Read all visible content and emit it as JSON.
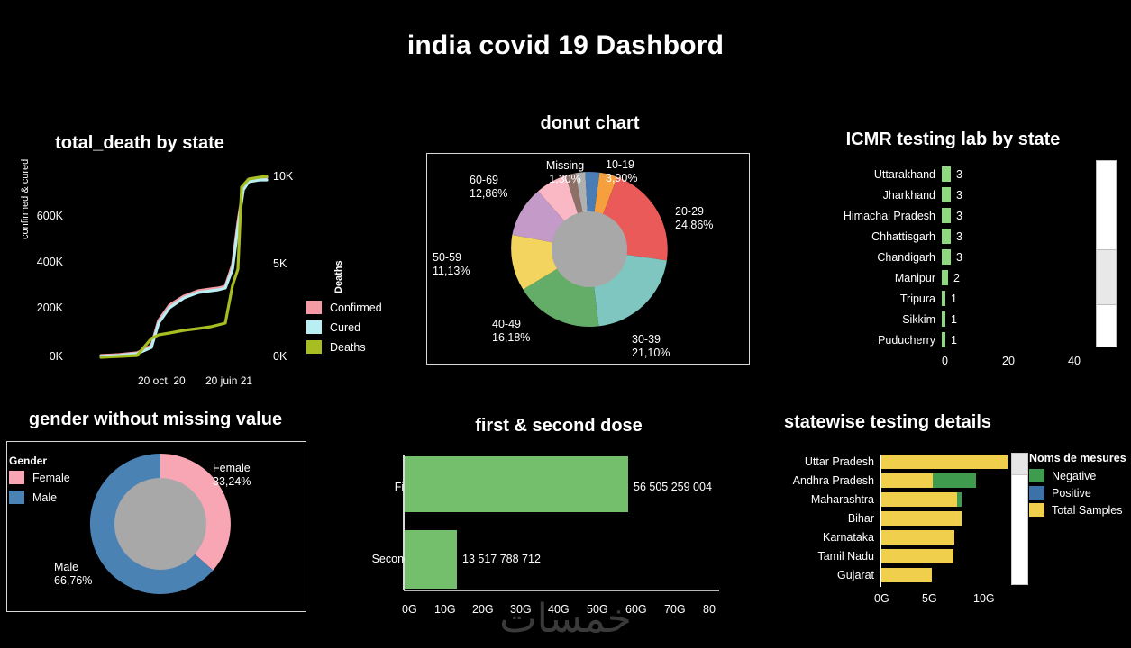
{
  "title": "india covid 19 Dashbord",
  "watermark": "خمسات",
  "line_chart": {
    "title": "total_death by state",
    "y_left_label": "confirmed & cured",
    "y_right_label": "Deaths",
    "y_left_ticks": [
      "600K",
      "400K",
      "200K",
      "0K"
    ],
    "y_right_ticks": [
      "10K",
      "5K",
      "0K"
    ],
    "x_ticks": [
      "20 oct. 20",
      "20 juin 21"
    ],
    "legend": [
      {
        "label": "Confirmed",
        "color": "#f49ba5"
      },
      {
        "label": "Cured",
        "color": "#b9eef2"
      },
      {
        "label": "Deaths",
        "color": "#a7bd22"
      }
    ]
  },
  "donut_chart": {
    "title": "donut chart",
    "labels": {
      "missing_name": "Missing",
      "missing_pct": "1,30%",
      "a1019_name": "10-19",
      "a1019_pct": "3,90%",
      "a2029_name": "20-29",
      "a2029_pct": "24,86%",
      "a3039_name": "30-39",
      "a3039_pct": "21,10%",
      "a4049_name": "40-49",
      "a4049_pct": "16,18%",
      "a5059_name": "50-59",
      "a5059_pct": "11,13%",
      "a6069_name": "60-69",
      "a6069_pct": "12,86%"
    }
  },
  "icmr_chart": {
    "title": "ICMR testing lab by state",
    "x_ticks": [
      "0",
      "20",
      "40"
    ],
    "rows": [
      {
        "state": "Uttarakhand",
        "value": "3"
      },
      {
        "state": "Jharkhand",
        "value": "3"
      },
      {
        "state": "Himachal Pradesh",
        "value": "3"
      },
      {
        "state": "Chhattisgarh",
        "value": "3"
      },
      {
        "state": "Chandigarh",
        "value": "3"
      },
      {
        "state": "Manipur",
        "value": "2"
      },
      {
        "state": "Tripura",
        "value": "1"
      },
      {
        "state": "Sikkim",
        "value": "1"
      },
      {
        "state": "Puducherry",
        "value": "1"
      }
    ]
  },
  "gender_chart": {
    "title": "gender without missing value",
    "legend_title": "Gender",
    "legend": [
      {
        "label": "Female",
        "color": "#f9a6b4"
      },
      {
        "label": "Male",
        "color": "#4a82b4"
      }
    ],
    "female_name": "Female",
    "female_pct": "33,24%",
    "male_name": "Male",
    "male_pct": "66,76%"
  },
  "dose_chart": {
    "title": "first & second dose",
    "categories": [
      "First",
      "Second"
    ],
    "values": [
      "56 505 259 004",
      "13 517 788 712"
    ],
    "x_ticks": [
      "0G",
      "10G",
      "20G",
      "30G",
      "40G",
      "50G",
      "60G",
      "70G",
      "80"
    ]
  },
  "statewise_chart": {
    "title": "statewise testing details",
    "legend_title": "Noms de mesures",
    "legend": [
      {
        "label": "Negative",
        "color": "#3f9b4e"
      },
      {
        "label": "Positive",
        "color": "#3d72a8"
      },
      {
        "label": "Total Samples",
        "color": "#f0cf4d"
      }
    ],
    "x_ticks": [
      "0G",
      "5G",
      "10G"
    ],
    "rows": [
      {
        "state": "Uttar Pradesh"
      },
      {
        "state": "Andhra Pradesh"
      },
      {
        "state": "Maharashtra"
      },
      {
        "state": "Bihar"
      },
      {
        "state": "Karnataka"
      },
      {
        "state": "Tamil Nadu"
      },
      {
        "state": "Gujarat"
      }
    ]
  },
  "chart_data": [
    {
      "type": "line",
      "title": "total_death by state",
      "xlabel": "",
      "ylabel": "confirmed & cured",
      "y2label": "Deaths",
      "ylim": [
        0,
        700000
      ],
      "y2lim": [
        0,
        10500
      ],
      "yticks": [
        0,
        200000,
        400000,
        600000
      ],
      "y2ticks": [
        0,
        5000,
        10000
      ],
      "xticks": [
        "20 oct. 20",
        "20 juin 21"
      ],
      "grid": false,
      "legend_position": "right",
      "series": [
        {
          "name": "Confirmed",
          "color": "#f49ba5",
          "x": [
            0,
            0.1,
            0.2,
            0.28,
            0.34,
            0.4,
            0.48,
            0.56,
            0.62,
            0.66,
            0.7,
            0.74,
            0.78,
            0.82,
            0.88,
            0.95,
            1.0
          ],
          "values": [
            2000,
            4000,
            10000,
            60000,
            150000,
            200000,
            240000,
            262000,
            268000,
            272000,
            276000,
            340000,
            520000,
            650000,
            685000,
            695000,
            697000
          ]
        },
        {
          "name": "Cured",
          "color": "#b9eef2",
          "x": [
            0,
            0.1,
            0.2,
            0.28,
            0.34,
            0.4,
            0.48,
            0.56,
            0.62,
            0.66,
            0.7,
            0.74,
            0.78,
            0.82,
            0.88,
            0.95,
            1.0
          ],
          "values": [
            1000,
            3000,
            7000,
            50000,
            140000,
            193000,
            234000,
            258000,
            264000,
            268000,
            272000,
            320000,
            495000,
            640000,
            678000,
            688000,
            690000
          ]
        },
        {
          "name": "Deaths",
          "color": "#a7bd22",
          "axis": "right",
          "x": [
            0,
            0.1,
            0.2,
            0.28,
            0.34,
            0.4,
            0.48,
            0.56,
            0.62,
            0.66,
            0.7,
            0.74,
            0.78,
            0.82,
            0.88,
            0.95,
            1.0
          ],
          "values": [
            30,
            60,
            120,
            1100,
            1500,
            1700,
            1850,
            1950,
            2050,
            2150,
            2250,
            5600,
            9600,
            9900,
            10050,
            10100,
            10100
          ]
        }
      ]
    },
    {
      "type": "pie",
      "title": "donut chart",
      "donut": true,
      "labels": [
        "10-19",
        "20-29",
        "30-39",
        "40-49",
        "50-59",
        "60-69",
        "Missing"
      ],
      "values": [
        3.9,
        24.86,
        21.1,
        16.18,
        11.13,
        12.86,
        1.3
      ],
      "value_labels": [
        "3,90%",
        "24,86%",
        "21,10%",
        "16,18%",
        "11,13%",
        "12,86%",
        "1,30%"
      ],
      "colors": [
        "#f5a03c",
        "#ea5a58",
        "#7fc6c0",
        "#63ad68",
        "#f2d45e",
        "#c39ac8",
        "#f9a8bc"
      ],
      "extra_slices": [
        {
          "label": "0-9",
          "value": 2.6,
          "color": "#4a7cb5"
        },
        {
          "label": "unknown-grey",
          "value": 1.3,
          "color": "#b0b0b0"
        },
        {
          "label": "unknown-brown",
          "value": 1.3,
          "color": "#8d6f68"
        },
        {
          "label": "unknown-pink",
          "value": 3.77,
          "color": "#f9b8c4"
        }
      ]
    },
    {
      "type": "bar",
      "orientation": "horizontal",
      "title": "ICMR testing lab by state",
      "categories": [
        "Uttarakhand",
        "Jharkhand",
        "Himachal Pradesh",
        "Chhattisgarh",
        "Chandigarh",
        "Manipur",
        "Tripura",
        "Sikkim",
        "Puducherry"
      ],
      "values": [
        3,
        3,
        3,
        3,
        3,
        2,
        1,
        1,
        1
      ],
      "xlim": [
        0,
        50
      ],
      "xticks": [
        0,
        20,
        40
      ],
      "color": "#8ed97f",
      "scrollable": true
    },
    {
      "type": "pie",
      "title": "gender without missing value",
      "donut": true,
      "labels": [
        "Female",
        "Male"
      ],
      "values": [
        33.24,
        66.76
      ],
      "value_labels": [
        "33,24%",
        "66,76%"
      ],
      "colors": [
        "#f9a6b4",
        "#4a82b4"
      ],
      "legend_title": "Gender",
      "legend_position": "left"
    },
    {
      "type": "bar",
      "orientation": "horizontal",
      "title": "first & second dose",
      "categories": [
        "First",
        "Second"
      ],
      "values": [
        56505259004,
        13517788712
      ],
      "value_labels": [
        "56 505 259 004",
        "13 517 788 712"
      ],
      "xlim": [
        0,
        80000000000
      ],
      "xticks": [
        "0G",
        "10G",
        "20G",
        "30G",
        "40G",
        "50G",
        "60G",
        "70G",
        "80"
      ],
      "color": "#74bf6c"
    },
    {
      "type": "bar",
      "orientation": "horizontal",
      "stacked": true,
      "title": "statewise testing details",
      "legend_title": "Noms de mesures",
      "categories": [
        "Uttar Pradesh",
        "Andhra Pradesh",
        "Maharashtra",
        "Bihar",
        "Karnataka",
        "Tamil Nadu",
        "Gujarat"
      ],
      "xlim": [
        0,
        12
      ],
      "xticks": [
        "0G",
        "5G",
        "10G"
      ],
      "series": [
        {
          "name": "Total Samples",
          "color": "#f0cf4d",
          "values": [
            11.0,
            5.3,
            7.5,
            7.6,
            7.0,
            6.9,
            4.8
          ]
        },
        {
          "name": "Negative",
          "color": "#3f9b4e",
          "values": [
            0,
            3.6,
            0.25,
            0,
            0,
            0,
            0
          ]
        },
        {
          "name": "Positive",
          "color": "#3d72a8",
          "values": [
            0,
            0,
            0,
            0,
            0,
            0,
            0
          ]
        }
      ],
      "scrollable": true
    }
  ]
}
